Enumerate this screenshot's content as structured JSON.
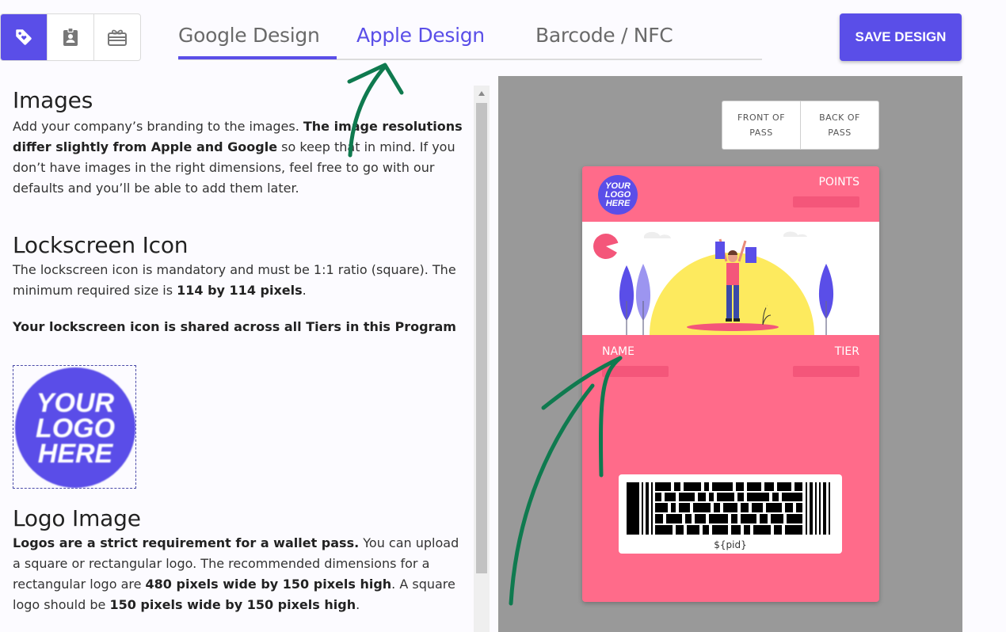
{
  "toolbar": {
    "icons": [
      "tag-icon",
      "badge-icon",
      "gift-card-icon"
    ],
    "save_label": "SAVE DESIGN"
  },
  "tabs": [
    {
      "label": "Google Design",
      "active": false
    },
    {
      "label": "Apple Design",
      "active": true
    },
    {
      "label": "Barcode / NFC",
      "active": false
    }
  ],
  "sections": {
    "images": {
      "title": "Images",
      "p1": "Add your company’s branding to the images. ",
      "p1_bold": "The image resolutions differ slightly from Apple and Google",
      "p1_rest": " so keep that in mind. If you don’t have images in the right dimensions, feel free to go with our defaults and you’ll be able to add them later."
    },
    "lockscreen": {
      "title": "Lockscreen Icon",
      "p1": "The lockscreen icon is mandatory and must be 1:1 ratio (square). The minimum required size is ",
      "p1_bold": "114 by 114 pixels",
      "p1_end": ".",
      "note": "Your lockscreen icon is shared across all Tiers in this Program",
      "logo_text": [
        "YOUR",
        "LOGO",
        "HERE"
      ]
    },
    "logo": {
      "title": "Logo Image",
      "b1": "Logos are a strict requirement for a wallet pass.",
      "t1": " You can upload a square or rectangular logo. The recommended dimensions for a rectangular logo are ",
      "b2": "480 pixels wide by 150 pixels high",
      "t2": ". A square logo should be ",
      "b3": "150 pixels wide by 150 pixels high",
      "t3": "."
    }
  },
  "preview": {
    "front_label": [
      "FRONT OF",
      "PASS"
    ],
    "back_label": [
      "BACK OF",
      "PASS"
    ],
    "card": {
      "logo_text": [
        "YOUR",
        "LOGO",
        "HERE"
      ],
      "points_label": "POINTS",
      "name_label": "NAME",
      "tier_label": "TIER",
      "barcode_text": "${pid}"
    }
  },
  "colors": {
    "accent": "#5a4ee8",
    "card": "#ff6b8a",
    "preview_bg": "#999999",
    "annotation": "#0f7a4f"
  }
}
